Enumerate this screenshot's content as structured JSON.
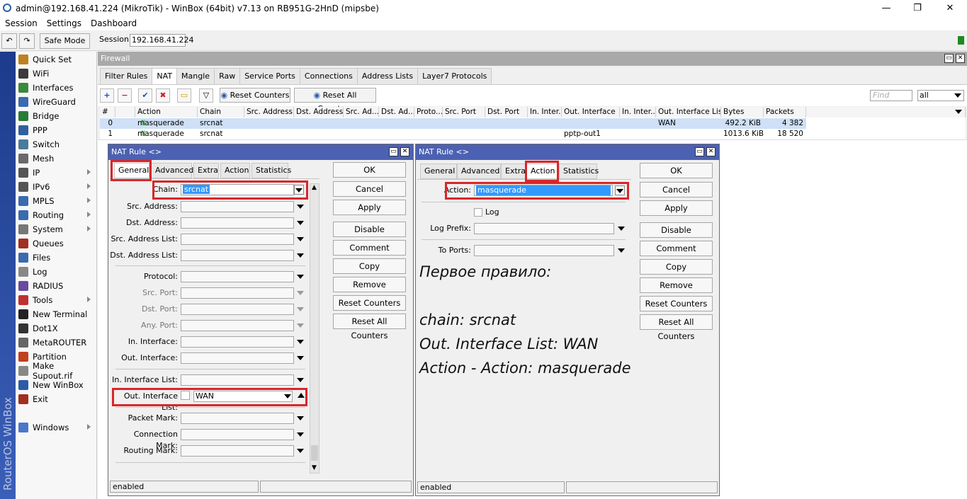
{
  "window": {
    "title": "admin@192.168.41.224 (MikroTik) - WinBox (64bit) v7.13 on RB951G-2HnD (mipsbe)",
    "minimize": "—",
    "restore": "❐",
    "close": "✕"
  },
  "menu": [
    "Session",
    "Settings",
    "Dashboard"
  ],
  "toolbar": {
    "undo": "↶",
    "redo": "↷",
    "safe_mode": "Safe Mode",
    "session_label": "Session:",
    "session_value": "192.168.41.224"
  },
  "sidebar": {
    "brand": "RouterOS WinBox",
    "items": [
      {
        "label": "Quick Set",
        "color": "#c08020",
        "arrow": false
      },
      {
        "label": "WiFi",
        "color": "#3a3a3a",
        "arrow": false
      },
      {
        "label": "Interfaces",
        "color": "#3a8a3a",
        "arrow": false
      },
      {
        "label": "WireGuard",
        "color": "#3a6ab0",
        "arrow": false
      },
      {
        "label": "Bridge",
        "color": "#2a7a3a",
        "arrow": false
      },
      {
        "label": "PPP",
        "color": "#3060a0",
        "arrow": false
      },
      {
        "label": "Switch",
        "color": "#4a7a9a",
        "arrow": false
      },
      {
        "label": "Mesh",
        "color": "#6a6a6a",
        "arrow": false
      },
      {
        "label": "IP",
        "color": "#555",
        "arrow": true
      },
      {
        "label": "IPv6",
        "color": "#555",
        "arrow": true
      },
      {
        "label": "MPLS",
        "color": "#3a6ab0",
        "arrow": true
      },
      {
        "label": "Routing",
        "color": "#3a6ab0",
        "arrow": true
      },
      {
        "label": "System",
        "color": "#777",
        "arrow": true
      },
      {
        "label": "Queues",
        "color": "#a03020",
        "arrow": false
      },
      {
        "label": "Files",
        "color": "#3a6ab0",
        "arrow": false
      },
      {
        "label": "Log",
        "color": "#888",
        "arrow": false
      },
      {
        "label": "RADIUS",
        "color": "#6a4aa0",
        "arrow": false
      },
      {
        "label": "Tools",
        "color": "#c03030",
        "arrow": true
      },
      {
        "label": "New Terminal",
        "color": "#222",
        "arrow": false
      },
      {
        "label": "Dot1X",
        "color": "#333",
        "arrow": false
      },
      {
        "label": "MetaROUTER",
        "color": "#666",
        "arrow": false
      },
      {
        "label": "Partition",
        "color": "#c04020",
        "arrow": false
      },
      {
        "label": "Make Supout.rif",
        "color": "#888",
        "arrow": false
      },
      {
        "label": "New WinBox",
        "color": "#2a5ca8",
        "arrow": false
      },
      {
        "label": "Exit",
        "color": "#a03020",
        "arrow": false
      }
    ],
    "windows": "Windows"
  },
  "firewall": {
    "title": "Firewall",
    "tabs": [
      "Filter Rules",
      "NAT",
      "Mangle",
      "Raw",
      "Service Ports",
      "Connections",
      "Address Lists",
      "Layer7 Protocols"
    ],
    "reset_counters": "Reset Counters",
    "reset_all_counters": "Reset All Counters",
    "find_placeholder": "Find",
    "filter_value": "all",
    "columns": [
      "#",
      "",
      "Action",
      "Chain",
      "Src. Address",
      "Dst. Address",
      "Src. Ad...",
      "Dst. Ad...",
      "Proto...",
      "Src. Port",
      "Dst. Port",
      "In. Inter...",
      "Out. Interface",
      "In. Inter...",
      "Out. Interface List",
      "Bytes",
      "Packets"
    ],
    "rows": [
      {
        "num": "0",
        "action": "masquerade",
        "chain": "srcnat",
        "out_if": "",
        "out_if_list": "WAN",
        "bytes": "492.2 KiB",
        "packets": "4 382"
      },
      {
        "num": "1",
        "action": "masquerade",
        "chain": "srcnat",
        "out_if": "pptp-out1",
        "out_if_list": "",
        "bytes": "1013.6 KiB",
        "packets": "18 520"
      }
    ]
  },
  "dialog1": {
    "title": "NAT Rule <>",
    "tabs": [
      "General",
      "Advanced",
      "Extra",
      "Action",
      "Statistics"
    ],
    "fields": [
      {
        "label": "Chain:",
        "value": "srcnat"
      },
      {
        "label": "Src. Address:",
        "value": ""
      },
      {
        "label": "Dst. Address:",
        "value": ""
      },
      {
        "label": "Src. Address List:",
        "value": ""
      },
      {
        "label": "Dst. Address List:",
        "value": ""
      },
      {
        "label": "Protocol:",
        "value": ""
      },
      {
        "label": "Src. Port:",
        "value": ""
      },
      {
        "label": "Dst. Port:",
        "value": ""
      },
      {
        "label": "Any. Port:",
        "value": ""
      },
      {
        "label": "In. Interface:",
        "value": ""
      },
      {
        "label": "Out. Interface:",
        "value": ""
      },
      {
        "label": "In. Interface List:",
        "value": ""
      },
      {
        "label": "Out. Interface List:",
        "value": "WAN"
      },
      {
        "label": "Packet Mark:",
        "value": ""
      },
      {
        "label": "Connection Mark:",
        "value": ""
      },
      {
        "label": "Routing Mark:",
        "value": ""
      }
    ],
    "buttons": [
      "OK",
      "Cancel",
      "Apply",
      "Disable",
      "Comment",
      "Copy",
      "Remove",
      "Reset Counters",
      "Reset All Counters"
    ],
    "status": "enabled"
  },
  "dialog2": {
    "title": "NAT Rule <>",
    "tabs": [
      "General",
      "Advanced",
      "Extra",
      "Action",
      "Statistics"
    ],
    "action_label": "Action:",
    "action_value": "masquerade",
    "log_label": "Log",
    "log_prefix_label": "Log Prefix:",
    "to_ports_label": "To Ports:",
    "buttons": [
      "OK",
      "Cancel",
      "Apply",
      "Disable",
      "Comment",
      "Copy",
      "Remove",
      "Reset Counters",
      "Reset All Counters"
    ],
    "status": "enabled"
  },
  "annotation": {
    "line1": "Первое правило:",
    "line2": "chain: srcnat",
    "line3": "Out. Interface List: WAN",
    "line4": "Action - Action: masquerade"
  }
}
